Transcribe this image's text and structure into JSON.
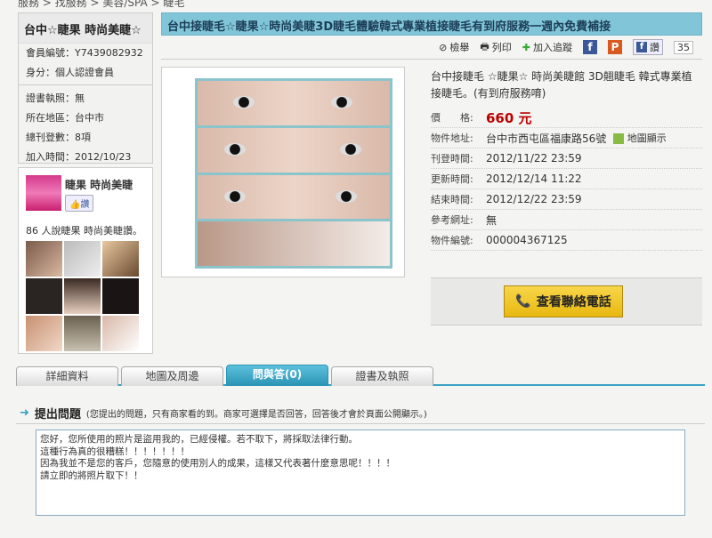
{
  "breadcrumb": "服務 > 找服務 > 美容/SPA > 睫毛",
  "member": {
    "name": "台中☆睫果 時尚美睫☆",
    "id": "會員編號：Y7439082932",
    "identity": "身分：個人認證會員",
    "license": "證書執照：無",
    "area": "所在地區：台中市",
    "count": "總刊登數：8項",
    "joined": "加入時間：2012/10/23"
  },
  "fb": {
    "page": "睫果 時尚美睫",
    "like": "讚",
    "count_text": "86 人說睫果 時尚美睫讚。"
  },
  "listing": {
    "title": "台中接睫毛☆睫果☆時尚美睫3D睫毛體驗韓式專業植接睫毛有到府服務一週內免費補接",
    "desc": "台中接睫毛 ☆睫果☆ 時尚美睫館 3D翹睫毛 韓式專業植接睫毛。(有到府服務唷)",
    "map_link": "地圖顯示",
    "rows": [
      {
        "k": "價　　格:",
        "v": "660 元"
      },
      {
        "k": "物件地址:",
        "v": "台中市西屯區福康路56號"
      },
      {
        "k": "刊登時間:",
        "v": "2012/11/22 23:59"
      },
      {
        "k": "更新時間:",
        "v": "2012/12/14 11:22"
      },
      {
        "k": "結束時間:",
        "v": "2012/12/22 23:59"
      },
      {
        "k": "參考網址:",
        "v": "無"
      },
      {
        "k": "物件編號:",
        "v": "000004367125"
      }
    ],
    "call": "查看聯絡電話"
  },
  "toolbar": {
    "report": "檢舉",
    "print": "列印",
    "track": "加入追蹤",
    "like": "讚",
    "like_count": "35"
  },
  "tabs": [
    "詳細資料",
    "地圖及周邊",
    "問與答(0)",
    "證書及執照"
  ],
  "question": {
    "title": "提出問題",
    "note": "(您提出的問題，只有商家看的到。商家可選擇是否回答，回答後才會於頁面公開顯示。)",
    "text": "您好，您所使用的照片是盜用我的，已經侵權。若不取下，將採取法律行動。\n這種行為真的很糟糕！！！！！！！\n因為我並不是您的客戶，您隨意的使用別人的成果，這樣又代表著什麼意思呢！！！！\n請立即的將照片取下！！"
  },
  "colors": {
    "title_bar": "#80c5d8",
    "accent": "#3aa2c2",
    "price": "#bb0000",
    "call_button": "#f0c830"
  }
}
